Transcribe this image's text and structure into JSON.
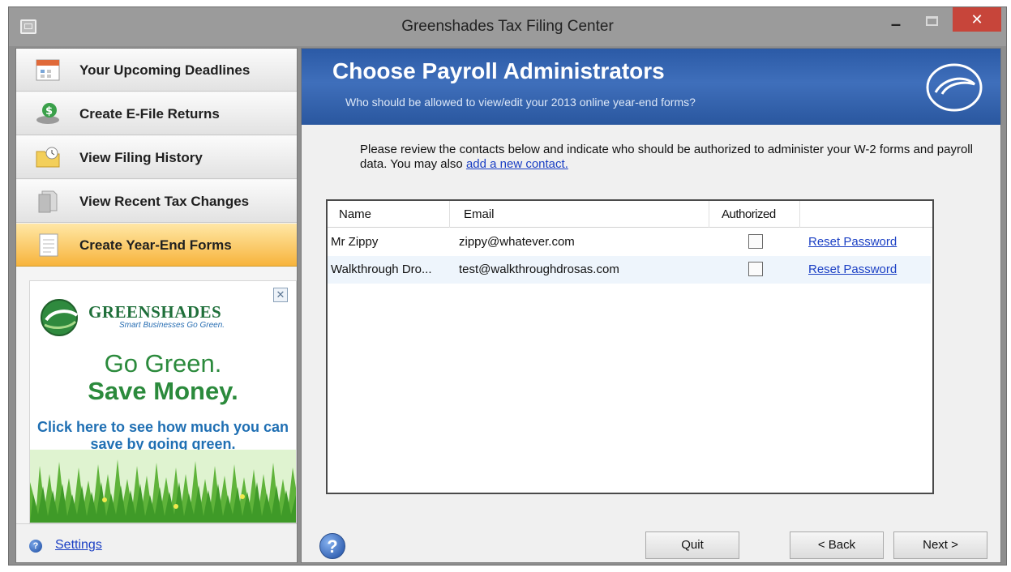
{
  "window": {
    "title": "Greenshades Tax Filing Center",
    "controls": {
      "minimize": "–",
      "close": "✕"
    }
  },
  "sidebar": {
    "items": [
      {
        "label": "Your Upcoming Deadlines",
        "icon": "calendar-icon",
        "active": false
      },
      {
        "label": "Create E-File Returns",
        "icon": "efile-icon",
        "active": false
      },
      {
        "label": "View Filing History",
        "icon": "folder-icon",
        "active": false
      },
      {
        "label": "View Recent Tax Changes",
        "icon": "document-icon",
        "active": false
      },
      {
        "label": "Create Year-End Forms",
        "icon": "form-icon",
        "active": true
      }
    ],
    "ad": {
      "brand": "GREENSHADES",
      "tagline": "Smart Businesses Go Green.",
      "headline1": "Go Green.",
      "headline2": "Save Money.",
      "cta": "Click here to see how much you can save by going green.",
      "close_icon": "close-icon"
    },
    "settings_label": "Settings"
  },
  "banner": {
    "title": "Choose Payroll Administrators",
    "subtitle": "Who should be allowed to view/edit your 2013 online year-end forms?",
    "logo_icon": "greenshades-swirl-icon"
  },
  "intro": {
    "text": "Please review the contacts below and indicate who should be authorized to administer your W-2 forms and payroll data. You may also ",
    "link": "add a new contact."
  },
  "table": {
    "columns": [
      "Name",
      "Email",
      "Authorized"
    ],
    "rows": [
      {
        "name": "Mr Zippy",
        "email": "zippy@whatever.com",
        "authorized": false,
        "action": "Reset Password"
      },
      {
        "name": "Walkthrough Dro...",
        "email": "test@walkthroughdrosas.com",
        "authorized": false,
        "action": "Reset Password"
      }
    ]
  },
  "footer": {
    "quit": "Quit",
    "back": "< Back",
    "next": "Next >",
    "help_icon": "help-icon"
  },
  "colors": {
    "banner": "#3f6fbb",
    "active_nav": "#f7b43c",
    "link": "#1a3fc4",
    "close_button": "#c7453a"
  }
}
